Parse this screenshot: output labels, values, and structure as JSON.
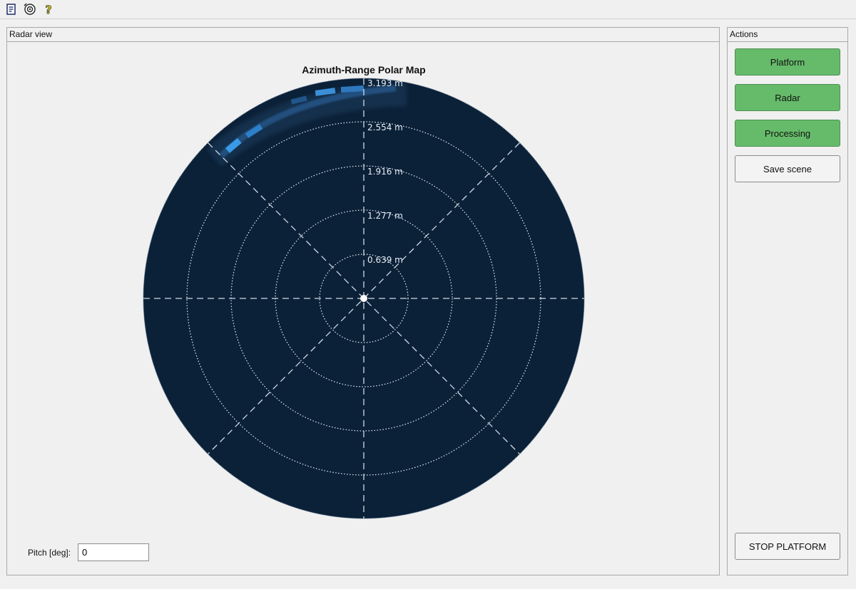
{
  "toolbar": {
    "icons": [
      "document-icon",
      "target-icon",
      "help-icon"
    ]
  },
  "radar_view": {
    "title": "Radar view",
    "chart": {
      "title": "Azimuth-Range Polar Map",
      "range_labels": [
        "0.639 m",
        "1.277 m",
        "1.916 m",
        "2.554 m",
        "3.193 m"
      ],
      "max_range": 3.193,
      "colors": {
        "background": "#0b2138",
        "grid": "#e6edf5",
        "hot": "#3a9ae8"
      }
    },
    "pitch": {
      "label": "Pitch [deg]:",
      "value": "0"
    }
  },
  "actions": {
    "title": "Actions",
    "buttons": {
      "platform": "Platform",
      "radar": "Radar",
      "processing": "Processing",
      "save_scene": "Save scene",
      "stop_platform": "STOP PLATFORM"
    },
    "colors": {
      "active": "#66bb6a"
    }
  }
}
